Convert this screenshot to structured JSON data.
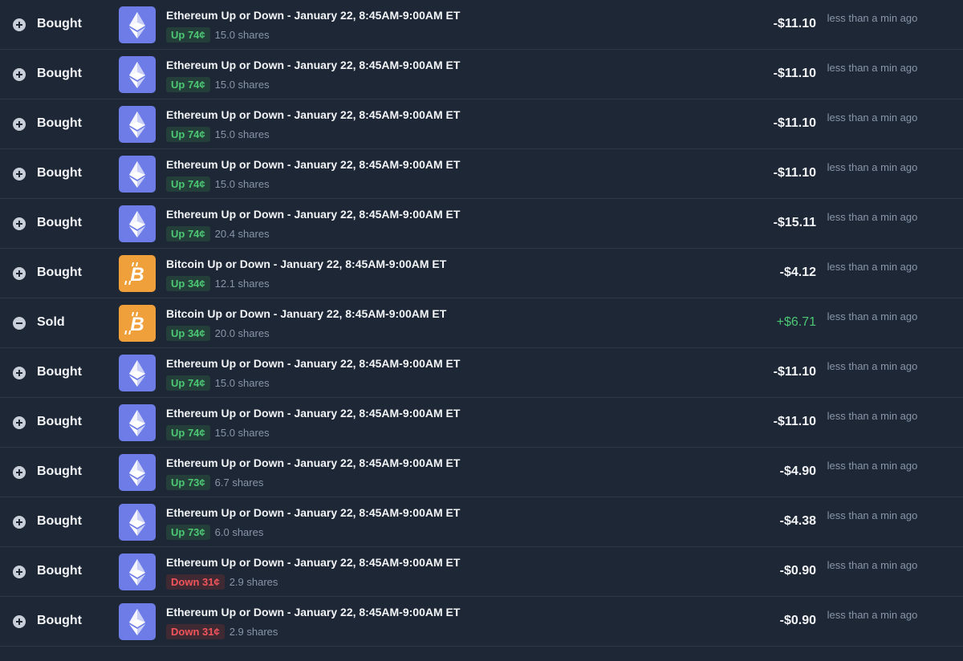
{
  "rows": [
    {
      "action": "Bought",
      "coin": "eth",
      "title": "Ethereum Up or Down - January 22, 8:45AM-9:00AM ET",
      "outcome": "Up 74¢",
      "side": "up",
      "shares": "15.0 shares",
      "amount": "-$11.10",
      "time": "less than a min ago"
    },
    {
      "action": "Bought",
      "coin": "eth",
      "title": "Ethereum Up or Down - January 22, 8:45AM-9:00AM ET",
      "outcome": "Up 74¢",
      "side": "up",
      "shares": "15.0 shares",
      "amount": "-$11.10",
      "time": "less than a min ago"
    },
    {
      "action": "Bought",
      "coin": "eth",
      "title": "Ethereum Up or Down - January 22, 8:45AM-9:00AM ET",
      "outcome": "Up 74¢",
      "side": "up",
      "shares": "15.0 shares",
      "amount": "-$11.10",
      "time": "less than a min ago"
    },
    {
      "action": "Bought",
      "coin": "eth",
      "title": "Ethereum Up or Down - January 22, 8:45AM-9:00AM ET",
      "outcome": "Up 74¢",
      "side": "up",
      "shares": "15.0 shares",
      "amount": "-$11.10",
      "time": "less than a min ago"
    },
    {
      "action": "Bought",
      "coin": "eth",
      "title": "Ethereum Up or Down - January 22, 8:45AM-9:00AM ET",
      "outcome": "Up 74¢",
      "side": "up",
      "shares": "20.4 shares",
      "amount": "-$15.11",
      "time": "less than a min ago"
    },
    {
      "action": "Bought",
      "coin": "btc",
      "title": "Bitcoin Up or Down - January 22, 8:45AM-9:00AM ET",
      "outcome": "Up 34¢",
      "side": "up",
      "shares": "12.1 shares",
      "amount": "-$4.12",
      "time": "less than a min ago"
    },
    {
      "action": "Sold",
      "coin": "btc",
      "title": "Bitcoin Up or Down - January 22, 8:45AM-9:00AM ET",
      "outcome": "Up 34¢",
      "side": "up",
      "shares": "20.0 shares",
      "amount": "+$6.71",
      "time": "less than a min ago"
    },
    {
      "action": "Bought",
      "coin": "eth",
      "title": "Ethereum Up or Down - January 22, 8:45AM-9:00AM ET",
      "outcome": "Up 74¢",
      "side": "up",
      "shares": "15.0 shares",
      "amount": "-$11.10",
      "time": "less than a min ago"
    },
    {
      "action": "Bought",
      "coin": "eth",
      "title": "Ethereum Up or Down - January 22, 8:45AM-9:00AM ET",
      "outcome": "Up 74¢",
      "side": "up",
      "shares": "15.0 shares",
      "amount": "-$11.10",
      "time": "less than a min ago"
    },
    {
      "action": "Bought",
      "coin": "eth",
      "title": "Ethereum Up or Down - January 22, 8:45AM-9:00AM ET",
      "outcome": "Up 73¢",
      "side": "up",
      "shares": "6.7 shares",
      "amount": "-$4.90",
      "time": "less than a min ago"
    },
    {
      "action": "Bought",
      "coin": "eth",
      "title": "Ethereum Up or Down - January 22, 8:45AM-9:00AM ET",
      "outcome": "Up 73¢",
      "side": "up",
      "shares": "6.0 shares",
      "amount": "-$4.38",
      "time": "less than a min ago"
    },
    {
      "action": "Bought",
      "coin": "eth",
      "title": "Ethereum Up or Down - January 22, 8:45AM-9:00AM ET",
      "outcome": "Down 31¢",
      "side": "down",
      "shares": "2.9 shares",
      "amount": "-$0.90",
      "time": "less than a min ago"
    },
    {
      "action": "Bought",
      "coin": "eth",
      "title": "Ethereum Up or Down - January 22, 8:45AM-9:00AM ET",
      "outcome": "Down 31¢",
      "side": "down",
      "shares": "2.9 shares",
      "amount": "-$0.90",
      "time": "less than a min ago"
    }
  ]
}
